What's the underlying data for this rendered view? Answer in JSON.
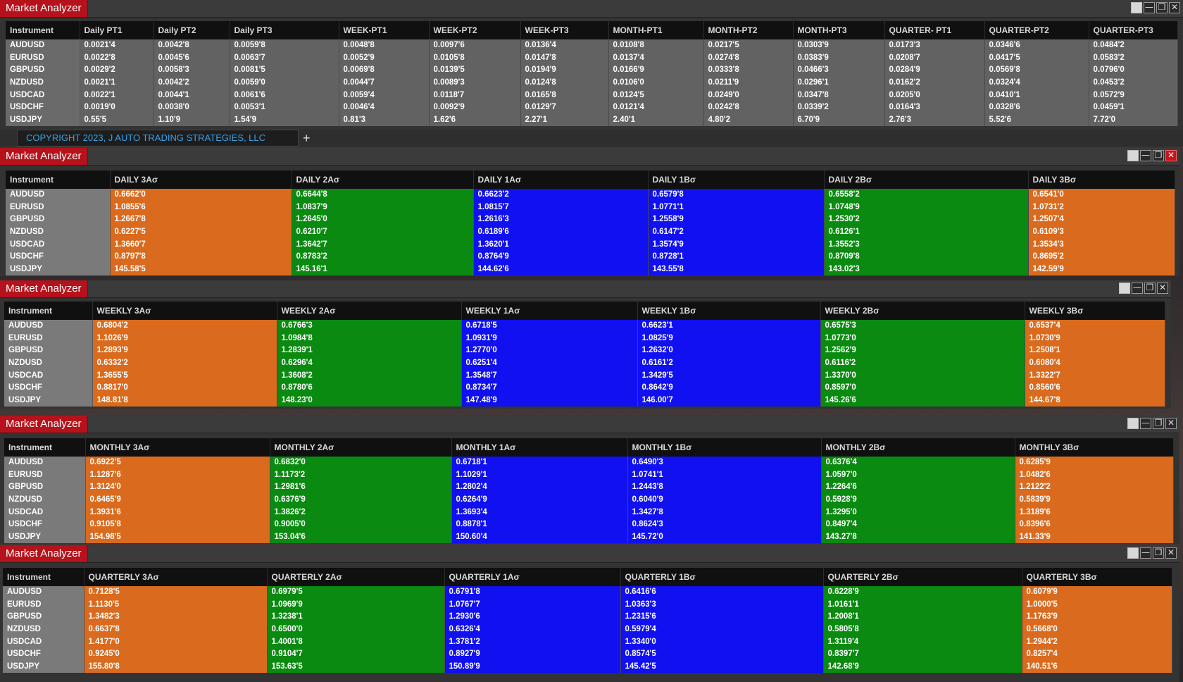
{
  "title": "Market Analyzer",
  "controls": [
    "☐",
    "—",
    "❐",
    "✕"
  ],
  "instruments": [
    "AUDUSD",
    "EURUSD",
    "GBPUSD",
    "NZDUSD",
    "USDCAD",
    "USDCHF",
    "USDJPY"
  ],
  "copyright_tab": "COPYRIGHT 2023, J AUTO TRADING STRATEGIES, LLC",
  "plus_label": "+",
  "panels": [
    {
      "headers": [
        "Instrument",
        "Daily PT1",
        "Daily PT2",
        "Daily PT3",
        "WEEK-PT1",
        "WEEK-PT2",
        "WEEK-PT3",
        "MONTH-PT1",
        "MONTH-PT2",
        "MONTH-PT3",
        "QUARTER- PT1",
        "QUARTER-PT2",
        "QUARTER-PT3"
      ],
      "rows": [
        [
          "0.0021'4",
          "0.0042'8",
          "0.0059'8",
          "0.0048'8",
          "0.0097'6",
          "0.0136'4",
          "0.0108'8",
          "0.0217'5",
          "0.0303'9",
          "0.0173'3",
          "0.0346'6",
          "0.0484'2"
        ],
        [
          "0.0022'8",
          "0.0045'6",
          "0.0063'7",
          "0.0052'9",
          "0.0105'8",
          "0.0147'8",
          "0.0137'4",
          "0.0274'8",
          "0.0383'9",
          "0.0208'7",
          "0.0417'5",
          "0.0583'2"
        ],
        [
          "0.0029'2",
          "0.0058'3",
          "0.0081'5",
          "0.0069'8",
          "0.0139'5",
          "0.0194'9",
          "0.0166'9",
          "0.0333'8",
          "0.0466'3",
          "0.0284'9",
          "0.0569'8",
          "0.0796'0"
        ],
        [
          "0.0021'1",
          "0.0042'2",
          "0.0059'0",
          "0.0044'7",
          "0.0089'3",
          "0.0124'8",
          "0.0106'0",
          "0.0211'9",
          "0.0296'1",
          "0.0162'2",
          "0.0324'4",
          "0.0453'2"
        ],
        [
          "0.0022'1",
          "0.0044'1",
          "0.0061'6",
          "0.0059'4",
          "0.0118'7",
          "0.0165'8",
          "0.0124'5",
          "0.0249'0",
          "0.0347'8",
          "0.0205'0",
          "0.0410'1",
          "0.0572'9"
        ],
        [
          "0.0019'0",
          "0.0038'0",
          "0.0053'1",
          "0.0046'4",
          "0.0092'9",
          "0.0129'7",
          "0.0121'4",
          "0.0242'8",
          "0.0339'2",
          "0.0164'3",
          "0.0328'6",
          "0.0459'1"
        ],
        [
          "0.55'5",
          "1.10'9",
          "1.54'9",
          "0.81'3",
          "1.62'6",
          "2.27'1",
          "2.40'1",
          "4.80'2",
          "6.70'9",
          "2.76'3",
          "5.52'6",
          "7.72'0"
        ]
      ]
    },
    {
      "headers": [
        "Instrument",
        "DAILY 3Aσ",
        "DAILY 2Aσ",
        "DAILY 1Aσ",
        "DAILY 1Bσ",
        "DAILY 2Bσ",
        "DAILY 3Bσ"
      ],
      "rows": [
        [
          "0.6662'0",
          "0.6644'8",
          "0.6623'2",
          "0.6579'8",
          "0.6558'2",
          "0.6541'0"
        ],
        [
          "1.0855'6",
          "1.0837'9",
          "1.0815'7",
          "1.0771'1",
          "1.0748'9",
          "1.0731'2"
        ],
        [
          "1.2667'8",
          "1.2645'0",
          "1.2616'3",
          "1.2558'9",
          "1.2530'2",
          "1.2507'4"
        ],
        [
          "0.6227'5",
          "0.6210'7",
          "0.6189'6",
          "0.6147'2",
          "0.6126'1",
          "0.6109'3"
        ],
        [
          "1.3660'7",
          "1.3642'7",
          "1.3620'1",
          "1.3574'9",
          "1.3552'3",
          "1.3534'3"
        ],
        [
          "0.8797'8",
          "0.8783'2",
          "0.8764'9",
          "0.8728'1",
          "0.8709'8",
          "0.8695'2"
        ],
        [
          "145.58'5",
          "145.16'1",
          "144.62'6",
          "143.55'8",
          "143.02'3",
          "142.59'9"
        ]
      ]
    },
    {
      "headers": [
        "Instrument",
        "WEEKLY 3Aσ",
        "WEEKLY 2Aσ",
        "WEEKLY 1Aσ",
        "WEEKLY 1Bσ",
        "WEEKLY 2Bσ",
        "WEEKLY 3Bσ"
      ],
      "rows": [
        [
          "0.6804'2",
          "0.6766'3",
          "0.6718'5",
          "0.6623'1",
          "0.6575'3",
          "0.6537'4"
        ],
        [
          "1.1026'9",
          "1.0984'8",
          "1.0931'9",
          "1.0825'9",
          "1.0773'0",
          "1.0730'9"
        ],
        [
          "1.2893'9",
          "1.2839'1",
          "1.2770'0",
          "1.2632'0",
          "1.2562'9",
          "1.2508'1"
        ],
        [
          "0.6332'2",
          "0.6296'4",
          "0.6251'4",
          "0.6161'2",
          "0.6116'2",
          "0.6080'4"
        ],
        [
          "1.3655'5",
          "1.3608'2",
          "1.3548'7",
          "1.3429'5",
          "1.3370'0",
          "1.3322'7"
        ],
        [
          "0.8817'0",
          "0.8780'6",
          "0.8734'7",
          "0.8642'9",
          "0.8597'0",
          "0.8560'6"
        ],
        [
          "148.81'8",
          "148.23'0",
          "147.48'9",
          "146.00'7",
          "145.26'6",
          "144.67'8"
        ]
      ]
    },
    {
      "headers": [
        "Instrument",
        "MONTHLY 3Aσ",
        "MONTHLY 2Aσ",
        "MONTHLY 1Aσ",
        "MONTHLY 1Bσ",
        "MONTHLY 2Bσ",
        "MONTHLY 3Bσ"
      ],
      "rows": [
        [
          "0.6922'5",
          "0.6832'0",
          "0.6718'1",
          "0.6490'3",
          "0.6376'4",
          "0.6285'9"
        ],
        [
          "1.1287'6",
          "1.1173'2",
          "1.1029'1",
          "1.0741'1",
          "1.0597'0",
          "1.0482'6"
        ],
        [
          "1.3124'0",
          "1.2981'6",
          "1.2802'4",
          "1.2443'8",
          "1.2264'6",
          "1.2122'2"
        ],
        [
          "0.6465'9",
          "0.6376'9",
          "0.6264'9",
          "0.6040'9",
          "0.5928'9",
          "0.5839'9"
        ],
        [
          "1.3931'6",
          "1.3826'2",
          "1.3693'4",
          "1.3427'8",
          "1.3295'0",
          "1.3189'6"
        ],
        [
          "0.9105'8",
          "0.9005'0",
          "0.8878'1",
          "0.8624'3",
          "0.8497'4",
          "0.8396'6"
        ],
        [
          "154.98'5",
          "153.04'6",
          "150.60'4",
          "145.72'0",
          "143.27'8",
          "141.33'9"
        ]
      ]
    },
    {
      "headers": [
        "Instrument",
        "QUARTERLY 3Aσ",
        "QUARTERLY 2Aσ",
        "QUARTERLY 1Aσ",
        "QUARTERLY 1Bσ",
        "QUARTERLY 2Bσ",
        "QUARTERLY 3Bσ"
      ],
      "rows": [
        [
          "0.7128'5",
          "0.6979'5",
          "0.6791'8",
          "0.6416'6",
          "0.6228'9",
          "0.6079'9"
        ],
        [
          "1.1130'5",
          "1.0969'9",
          "1.0767'7",
          "1.0363'3",
          "1.0161'1",
          "1.0000'5"
        ],
        [
          "1.3482'3",
          "1.3238'1",
          "1.2930'6",
          "1.2315'6",
          "1.2008'1",
          "1.1763'9"
        ],
        [
          "0.6637'8",
          "0.6500'0",
          "0.6326'4",
          "0.5979'4",
          "0.5805'8",
          "0.5668'0"
        ],
        [
          "1.4177'0",
          "1.4001'8",
          "1.3781'2",
          "1.3340'0",
          "1.3119'4",
          "1.2944'2"
        ],
        [
          "0.9245'0",
          "0.9104'7",
          "0.8927'9",
          "0.8574'5",
          "0.8397'7",
          "0.8257'4"
        ],
        [
          "155.80'8",
          "153.63'5",
          "150.89'9",
          "145.42'5",
          "142.68'9",
          "140.51'6"
        ]
      ]
    }
  ],
  "colors": {
    "orange": "#d96a1e",
    "green": "#0a8a10",
    "blue": "#1010f0",
    "title_red": "#b5121b",
    "copyright_blue": "#3aa0e6"
  }
}
